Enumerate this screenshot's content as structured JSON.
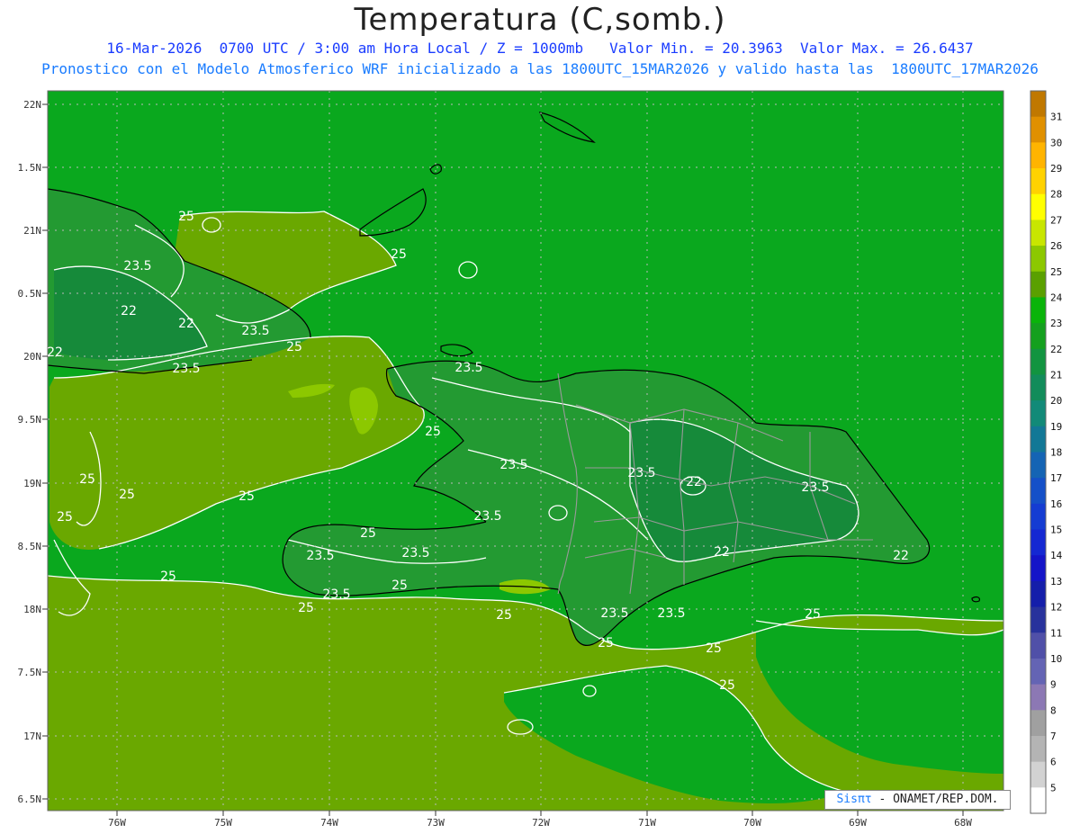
{
  "title": "Temperatura (C,somb.)",
  "subtitle_line1": "16-Mar-2026  0700 UTC / 3:00 am Hora Local / Z = 1000mb   Valor Min. = 20.3963  Valor Max. = 26.6437",
  "subtitle_line2": "Pronostico con el Modelo Atmosferico WRF inicializado a las 1800UTC_15MAR2026 y valido hasta las  1800UTC_17MAR2026",
  "credit": {
    "brand": "Sisπτ",
    "text": " - ONAMET/REP.DOM."
  },
  "lat_labels": [
    "22N",
    "1.5N",
    "21N",
    "0.5N",
    "20N",
    "9.5N",
    "19N",
    "8.5N",
    "18N",
    "7.5N",
    "17N",
    "6.5N"
  ],
  "lon_labels": [
    "76W",
    "75W",
    "74W",
    "73W",
    "72W",
    "71W",
    "70W",
    "69W",
    "68W"
  ],
  "contour_labels": [
    "25",
    "25",
    "23.5",
    "22",
    "22",
    "23.5",
    "25",
    "22",
    "23.5",
    "23.5",
    "25",
    "25",
    "25",
    "25",
    "25",
    "25",
    "23.5",
    "23.5",
    "25",
    "23.5",
    "23.5",
    "25",
    "25",
    "23.5",
    "23.5",
    "22",
    "23.5",
    "22",
    "22",
    "23.5",
    "23.5",
    "25",
    "25",
    "25",
    "25",
    "25"
  ],
  "colorbar": {
    "labels": [
      "31",
      "30",
      "29",
      "28",
      "27",
      "26",
      "25",
      "24",
      "23",
      "22",
      "21",
      "20",
      "19",
      "18",
      "17",
      "16",
      "15",
      "14",
      "13",
      "12",
      "11",
      "10",
      "9",
      "8",
      "7",
      "6",
      "5"
    ],
    "colors": [
      "#c07800",
      "#e09000",
      "#ffb400",
      "#ffd200",
      "#ffff00",
      "#c8e600",
      "#8cc800",
      "#5aa000",
      "#0ab40a",
      "#14a01e",
      "#129440",
      "#128c5a",
      "#128a78",
      "#127896",
      "#1464b4",
      "#1450c8",
      "#143cd2",
      "#1428d2",
      "#1414c8",
      "#141eaa",
      "#28329c",
      "#5050a8",
      "#6464b4",
      "#8c78b4",
      "#a0a0a0",
      "#b4b4b4",
      "#d2d2d2",
      "#ffffff"
    ]
  },
  "colors": {
    "sea": "#0aa81e",
    "low_land": "#6aa800",
    "land_island": "#239a32",
    "land_dark": "#168a3a",
    "warm_spot": "#8cc800",
    "contour": "#ffffff",
    "coast": "#000000",
    "border": "#9a9a9a"
  }
}
